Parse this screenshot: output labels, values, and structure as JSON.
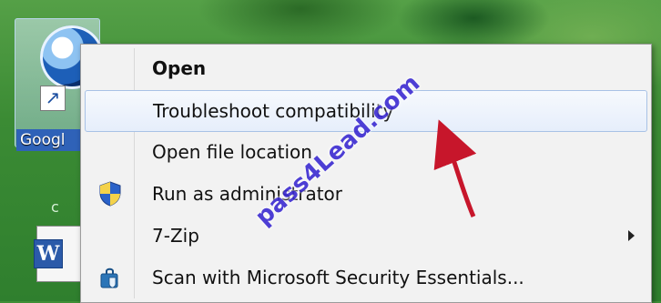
{
  "desktop": {
    "icon_label": "Googl",
    "small_text": "c"
  },
  "menu": {
    "items": [
      {
        "label": "Open",
        "bold": true
      },
      {
        "label": "Troubleshoot compatibility",
        "selected": true
      },
      {
        "label": "Open file location"
      },
      {
        "label": "Run as administrator",
        "icon": "uac-shield-icon"
      },
      {
        "label": "7-Zip",
        "submenu": true
      },
      {
        "label": "Scan with Microsoft Security Essentials...",
        "icon": "security-essentials-icon"
      }
    ]
  },
  "watermark": "pass4Lead.com",
  "colors": {
    "desktop_green": "#3f8f36",
    "selection_border": "#a8c2e6",
    "annotation_red": "#c7162b",
    "watermark_blue": "#3c2bd1"
  }
}
